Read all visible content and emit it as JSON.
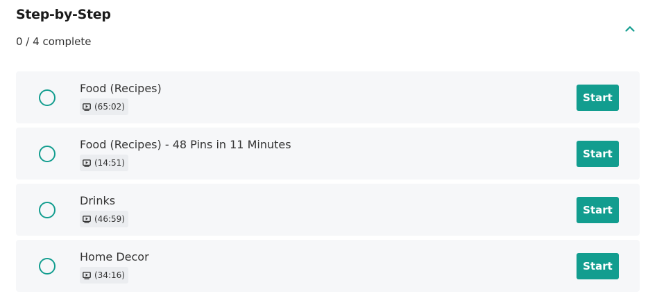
{
  "header": {
    "title": "Step-by-Step",
    "progress": "0 / 4 complete",
    "collapse_icon": "chevron-up-icon"
  },
  "colors": {
    "accent": "#129d8f",
    "row_background": "#f6f7f9",
    "badge_background": "#ebedf0"
  },
  "items": [
    {
      "title": "Food (Recipes)",
      "duration": "(65:02)",
      "button": "Start",
      "completed": false
    },
    {
      "title": "Food (Recipes) - 48 Pins in 11 Minutes",
      "duration": "(14:51)",
      "button": "Start",
      "completed": false
    },
    {
      "title": "Drinks",
      "duration": "(46:59)",
      "button": "Start",
      "completed": false
    },
    {
      "title": "Home Decor",
      "duration": "(34:16)",
      "button": "Start",
      "completed": false
    }
  ]
}
